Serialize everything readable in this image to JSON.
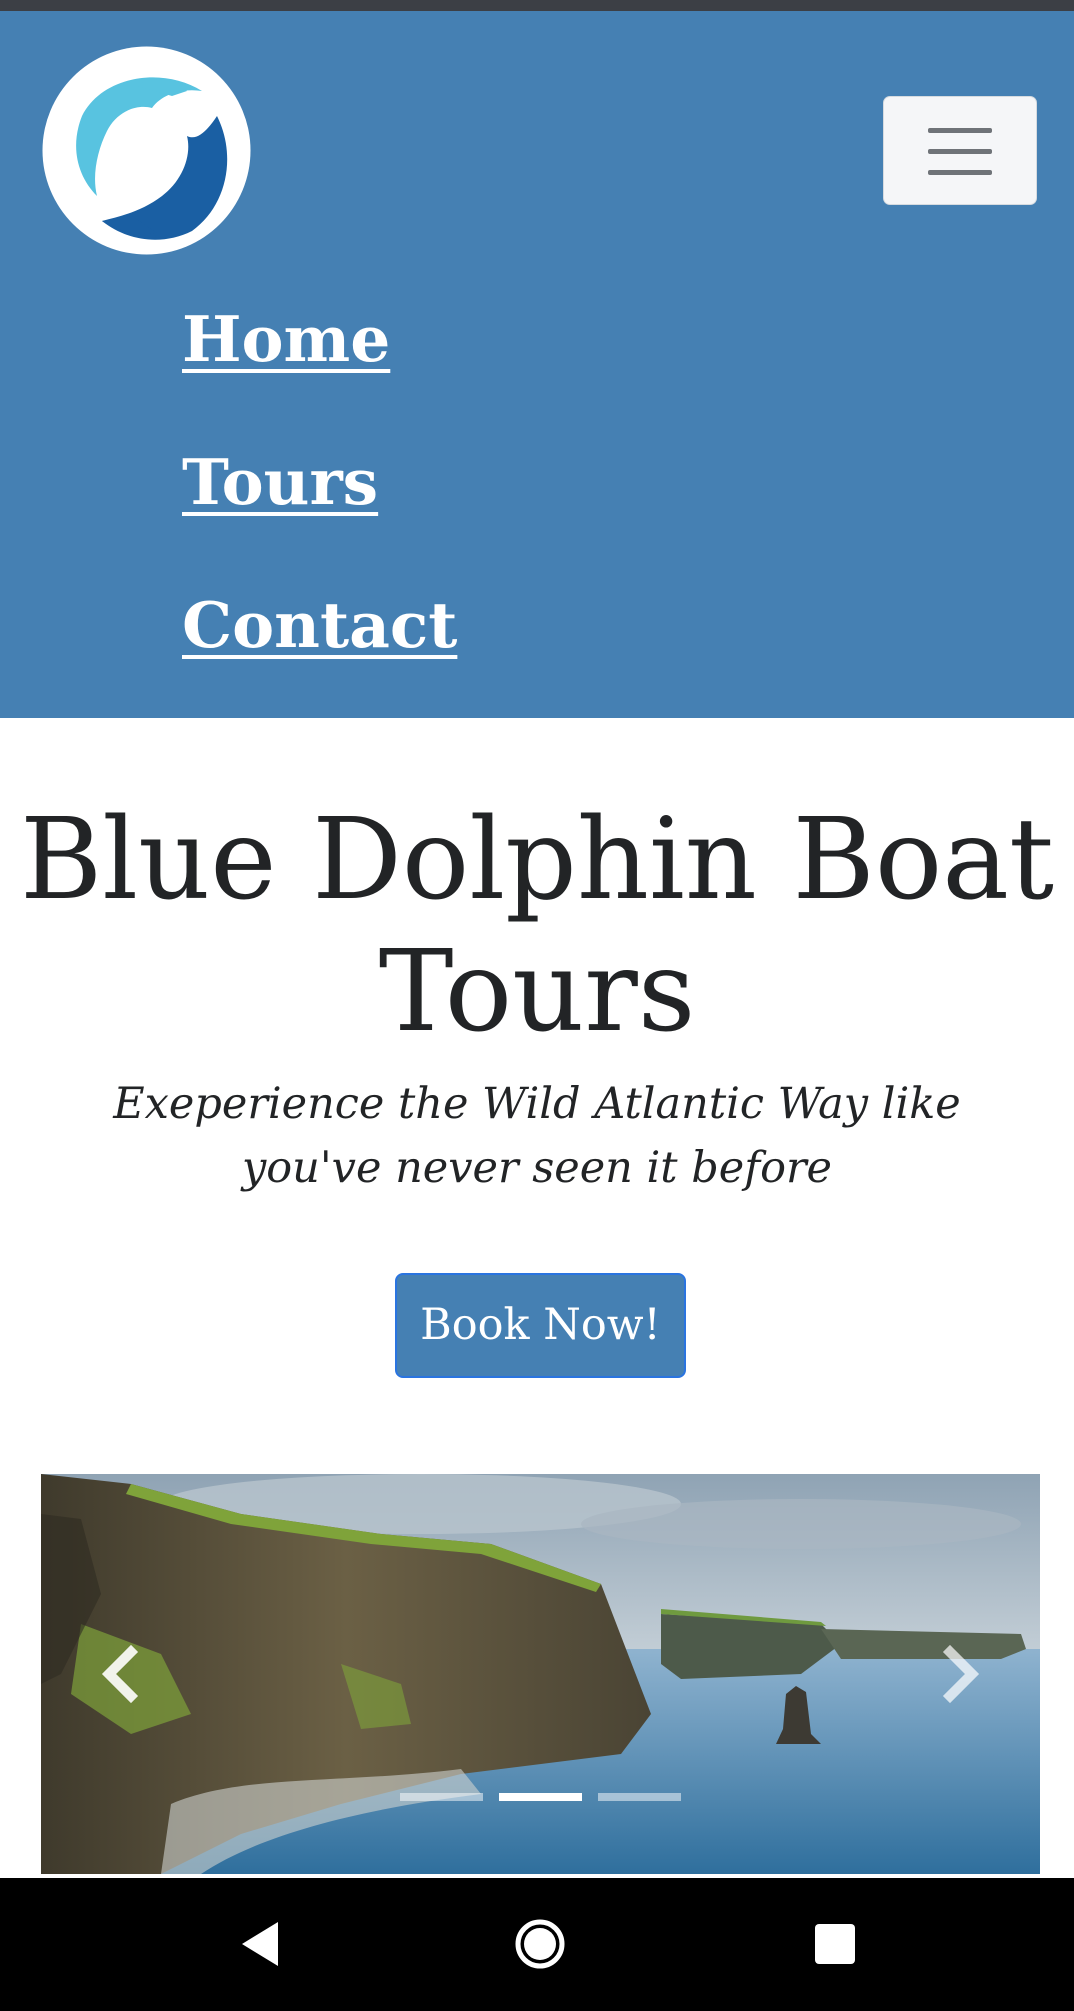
{
  "navbar": {
    "logo_icon": "dolphin-logo-icon",
    "toggle_icon": "hamburger-menu-icon",
    "links": [
      "Home",
      "Tours",
      "Contact"
    ]
  },
  "hero": {
    "title": "Blue Dolphin Boat Tours",
    "subtitle": "Exeperience the Wild Atlantic Way like you've never seen it before",
    "cta_label": "Book Now!"
  },
  "carousel": {
    "image": "cliffs-of-moher-image",
    "prev_icon": "chevron-left-icon",
    "next_icon": "chevron-right-icon",
    "slide_count": 3,
    "active_slide": 2
  },
  "system_nav": {
    "back_icon": "back-triangle-icon",
    "home_icon": "home-circle-icon",
    "recents_icon": "recents-square-icon"
  },
  "colors": {
    "navbar_bg": "#4580b3",
    "button_bg": "#4580b3",
    "title_text": "#222426",
    "status_bar": "#3c3f45"
  }
}
